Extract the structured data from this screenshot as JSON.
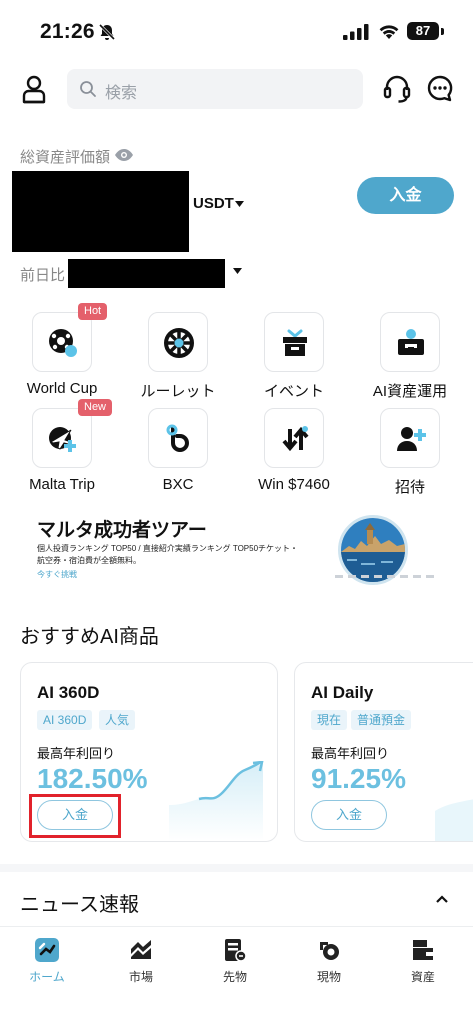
{
  "status_bar": {
    "time": "21:26",
    "battery": "87"
  },
  "header": {
    "search_placeholder": "検索"
  },
  "assets": {
    "label": "総資産評価額",
    "currency": "USDT",
    "deposit_label": "入金",
    "prev_day_label": "前日比"
  },
  "shortcuts": [
    {
      "label": "World Cup",
      "tag": "Hot",
      "icon": "soccer-ball-icon"
    },
    {
      "label": "ルーレット",
      "tag": "",
      "icon": "roulette-wheel-icon"
    },
    {
      "label": "イベント",
      "tag": "",
      "icon": "gift-box-icon"
    },
    {
      "label": "AI資産運用",
      "tag": "",
      "icon": "robot-briefcase-icon"
    },
    {
      "label": "Malta Trip",
      "tag": "New",
      "icon": "airplane-ball-icon"
    },
    {
      "label": "BXC",
      "tag": "",
      "icon": "bxc-logo-icon"
    },
    {
      "label": "Win $7460",
      "tag": "",
      "icon": "trade-arrows-icon"
    },
    {
      "label": "招待",
      "tag": "",
      "icon": "invite-user-icon"
    }
  ],
  "banner": {
    "title": "マルタ成功者ツアー",
    "description": "個人投資ランキング TOP50 / 直接紹介実績ランキング TOP50チケット・航空券・宿泊費が全額無料。",
    "link": "今すぐ挑戦"
  },
  "ai_products": {
    "title": "おすすめAI商品",
    "cards": [
      {
        "name": "AI 360D",
        "chips": [
          "AI 360D",
          "人気"
        ],
        "rate_label": "最高年利回り",
        "rate": "182.50%",
        "button": "入金"
      },
      {
        "name": "AI Daily",
        "chips": [
          "現在",
          "普通預金"
        ],
        "rate_label": "最高年利回り",
        "rate": "91.25%",
        "button": "入金"
      }
    ]
  },
  "news": {
    "title": "ニュース速報"
  },
  "bottom_nav": [
    {
      "label": "ホーム",
      "icon": "home-icon",
      "active": true
    },
    {
      "label": "市場",
      "icon": "market-icon",
      "active": false
    },
    {
      "label": "先物",
      "icon": "futures-icon",
      "active": false
    },
    {
      "label": "現物",
      "icon": "spot-icon",
      "active": false
    },
    {
      "label": "資産",
      "icon": "wallet-icon",
      "active": false
    }
  ],
  "colors": {
    "accent": "#4fa7cc",
    "rate": "#6cc0e0",
    "tag": "#e4606b",
    "highlight": "#e1222b"
  }
}
